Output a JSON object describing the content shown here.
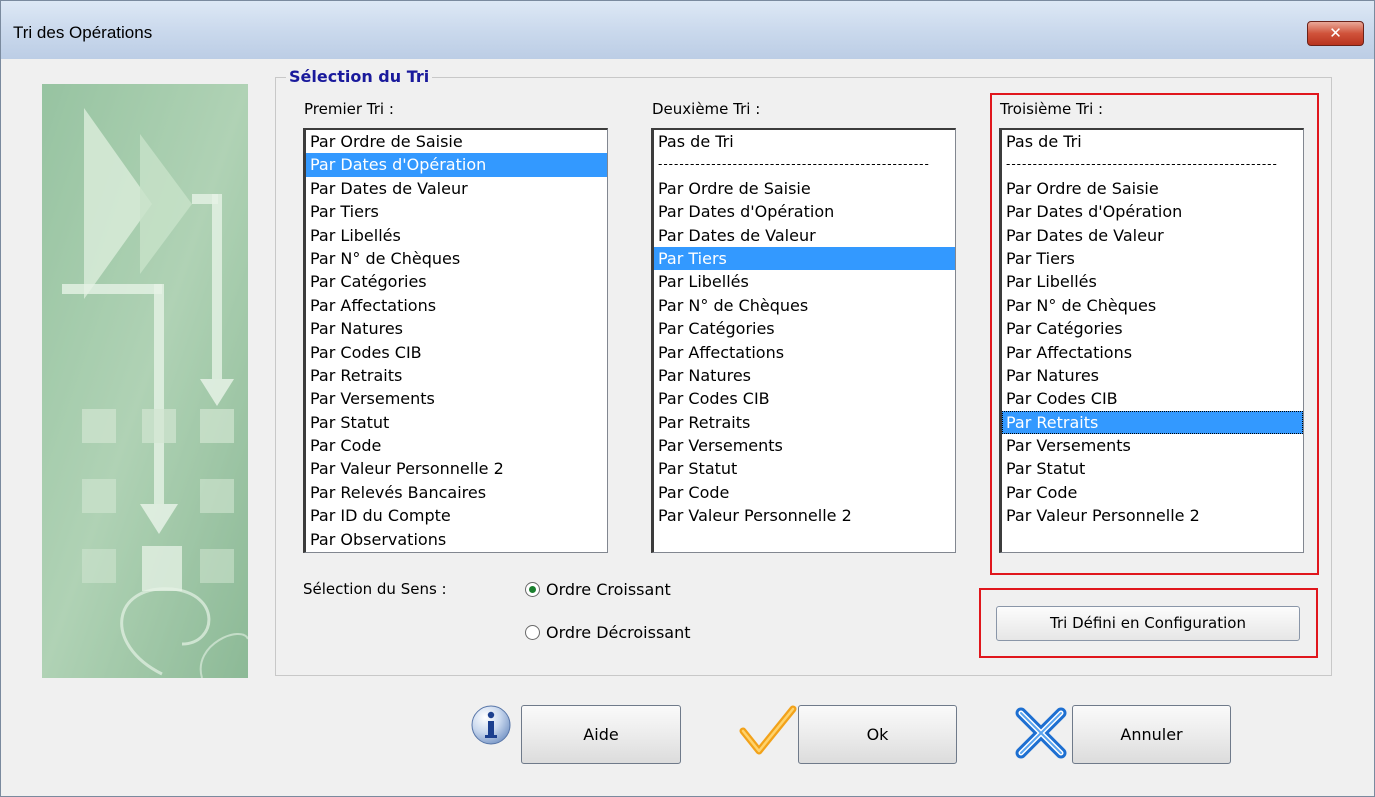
{
  "window": {
    "title": "Tri des Opérations",
    "close_glyph": "✕"
  },
  "group": {
    "title": "Sélection du Tri"
  },
  "columns": [
    {
      "label": "Premier Tri :"
    },
    {
      "label": "Deuxième Tri :"
    },
    {
      "label": "Troisième Tri :"
    }
  ],
  "list1": [
    "Par Ordre de Saisie",
    "Par Dates d'Opération",
    "Par Dates de Valeur",
    "Par Tiers",
    "Par Libellés",
    "Par N° de Chèques",
    "Par Catégories",
    "Par Affectations",
    "Par Natures",
    "Par Codes CIB",
    "Par Retraits",
    "Par Versements",
    "Par Statut",
    "Par Code",
    "Par Valeur Personnelle 2",
    "Par Relevés Bancaires",
    "Par ID du Compte",
    "Par Observations"
  ],
  "list2": [
    "Pas de Tri",
    "---------------------------------------------------",
    "Par Ordre de Saisie",
    "Par Dates d'Opération",
    "Par Dates de Valeur",
    "Par Tiers",
    "Par Libellés",
    "Par N° de Chèques",
    "Par Catégories",
    "Par Affectations",
    "Par Natures",
    "Par Codes CIB",
    "Par Retraits",
    "Par Versements",
    "Par Statut",
    "Par Code",
    "Par Valeur Personnelle 2"
  ],
  "list3": [
    "Pas de Tri",
    "---------------------------------------------------",
    "Par Ordre de Saisie",
    "Par Dates d'Opération",
    "Par Dates de Valeur",
    "Par Tiers",
    "Par Libellés",
    "Par N° de Chèques",
    "Par Catégories",
    "Par Affectations",
    "Par Natures",
    "Par Codes CIB",
    "Par Retraits",
    "Par Versements",
    "Par Statut",
    "Par Code",
    "Par Valeur Personnelle 2"
  ],
  "selected": {
    "list1": "Par Dates d'Opération",
    "list2": "Par Tiers",
    "list3": "Par Retraits"
  },
  "sens": {
    "label": "Sélection du Sens :",
    "options": [
      "Ordre Croissant",
      "Ordre Décroissant"
    ],
    "selected": "Ordre Croissant"
  },
  "buttons": {
    "config": "Tri Défini en Configuration",
    "aide": "Aide",
    "ok": "Ok",
    "annuler": "Annuler"
  },
  "icons": {
    "aide": "info-icon",
    "ok": "checkmark-icon",
    "annuler": "cross-icon",
    "close": "close-icon"
  },
  "colors": {
    "selection": "#3399ff",
    "highlight": "#e0161c",
    "group_title": "#1a1a9c"
  }
}
